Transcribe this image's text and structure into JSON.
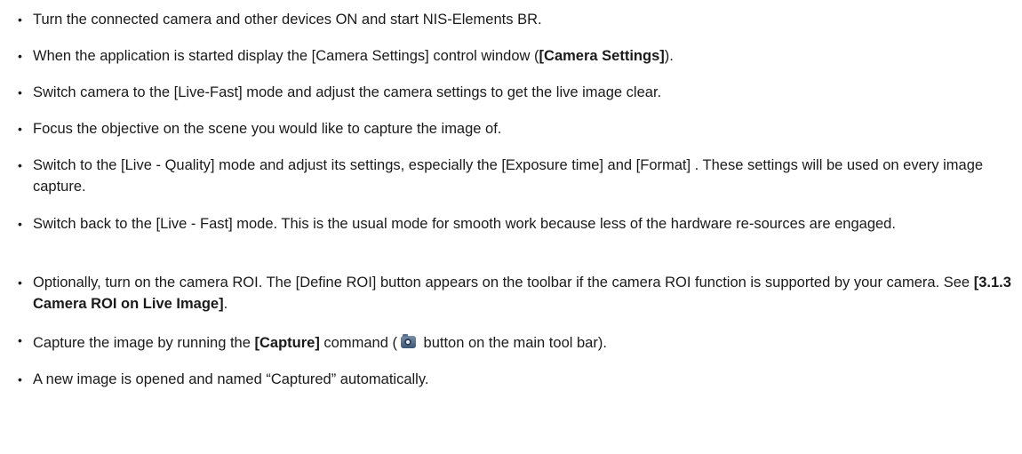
{
  "steps": [
    {
      "text": "Turn the connected camera and other devices ON and start NIS-Elements BR."
    },
    {
      "a": "When the application is started display the [Camera Settings] control window (",
      "b": "[Camera Settings]",
      "c": ")."
    },
    {
      "text": "Switch camera to the [Live-Fast] mode and adjust the camera settings to get the live image clear."
    },
    {
      "text": "Focus the objective on the scene you would like to capture the image of."
    },
    {
      "text": "Switch to the [Live - Quality] mode and adjust its settings, especially the [Exposure time] and [Format] . These settings will be used on every image capture."
    },
    {
      "text": "Switch back to the [Live - Fast] mode. This is the usual mode for smooth work because less of the hardware re-sources are engaged."
    },
    {
      "a": "Optionally, turn on the camera ROI. The [Define ROI] button appears on the toolbar if the camera ROI function is supported by your camera. See ",
      "b": "[3.1.3 Camera ROI on Live Image]",
      "c": "."
    },
    {
      "a": "Capture the image by running the ",
      "b": "[Capture]",
      "c": " command (",
      "icon": "camera-icon",
      "d": " button on the main tool bar)."
    },
    {
      "text": "A new image is opened and named “Captured” automatically."
    }
  ]
}
